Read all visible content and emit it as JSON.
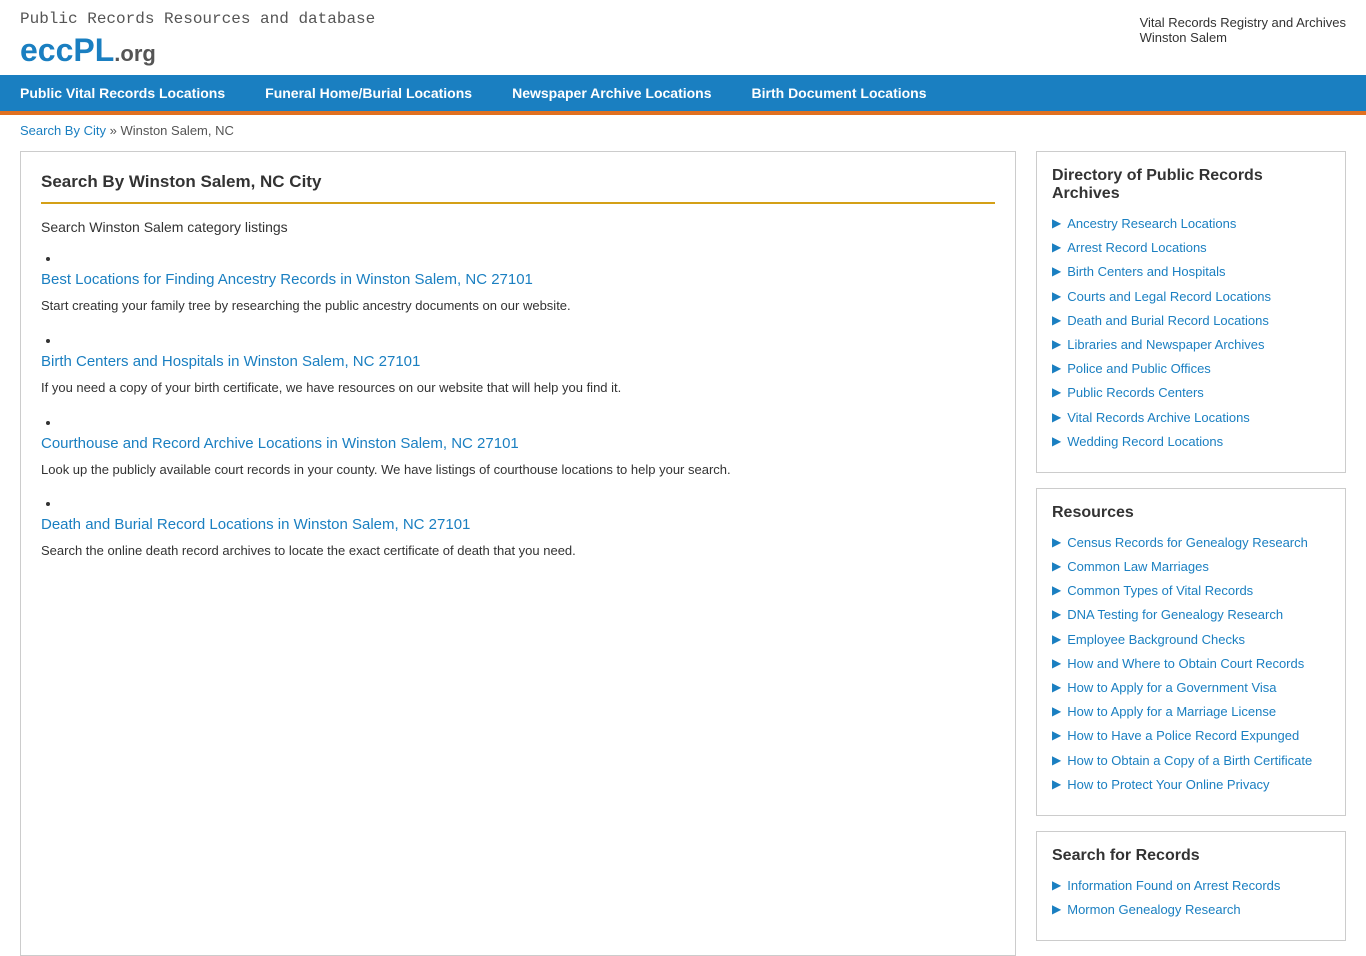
{
  "header": {
    "tagline": "Public Records Resources and database",
    "logo_ecc": "ecc",
    "logo_pl": "PL",
    "logo_org": ".org",
    "registry_label": "Vital Records Registry and Archives",
    "city_label": "Winston Salem"
  },
  "nav": {
    "items": [
      {
        "label": "Public Vital Records Locations",
        "href": "#"
      },
      {
        "label": "Funeral Home/Burial Locations",
        "href": "#"
      },
      {
        "label": "Newspaper Archive Locations",
        "href": "#"
      },
      {
        "label": "Birth Document Locations",
        "href": "#"
      }
    ]
  },
  "breadcrumb": {
    "link_text": "Search By City",
    "separator": " » ",
    "current": "Winston Salem, NC"
  },
  "content": {
    "title": "Search By Winston Salem, NC City",
    "subtitle": "Search Winston Salem category listings",
    "sections": [
      {
        "link": "Best Locations for Finding Ancestry Records in Winston Salem, NC 27101",
        "desc": "Start creating your family tree by researching the public ancestry documents on our website."
      },
      {
        "link": "Birth Centers and Hospitals in Winston Salem, NC 27101",
        "desc": "If you need a copy of your birth certificate, we have resources on our website that will help you find it."
      },
      {
        "link": "Courthouse and Record Archive Locations in Winston Salem, NC 27101",
        "desc": "Look up the publicly available court records in your county. We have listings of courthouse locations to help your search."
      },
      {
        "link": "Death and Burial Record Locations in Winston Salem, NC 27101",
        "desc": "Search the online death record archives to locate the exact certificate of death that you need."
      }
    ]
  },
  "sidebar": {
    "directory_title": "Directory of Public Records Archives",
    "directory_links": [
      "Ancestry Research Locations",
      "Arrest Record Locations",
      "Birth Centers and Hospitals",
      "Courts and Legal Record Locations",
      "Death and Burial Record Locations",
      "Libraries and Newspaper Archives",
      "Police and Public Offices",
      "Public Records Centers",
      "Vital Records Archive Locations",
      "Wedding Record Locations"
    ],
    "resources_title": "Resources",
    "resources_links": [
      "Census Records for Genealogy Research",
      "Common Law Marriages",
      "Common Types of Vital Records",
      "DNA Testing for Genealogy Research",
      "Employee Background Checks",
      "How and Where to Obtain Court Records",
      "How to Apply for a Government Visa",
      "How to Apply for a Marriage License",
      "How to Have a Police Record Expunged",
      "How to Obtain a Copy of a Birth Certificate",
      "How to Protect Your Online Privacy"
    ],
    "search_title": "Search for Records",
    "search_links": [
      "Information Found on Arrest Records",
      "Mormon Genealogy Research"
    ]
  }
}
